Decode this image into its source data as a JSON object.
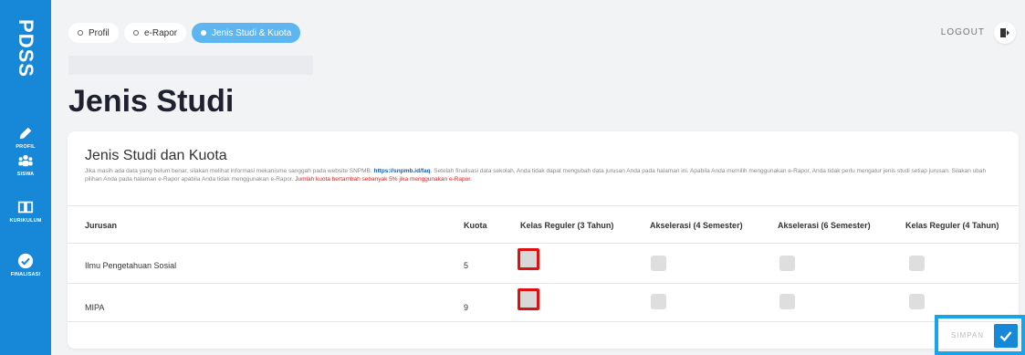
{
  "sidebar": {
    "brand": "PDSS",
    "items": [
      {
        "label": "PROFIL",
        "icon": "pencil-icon"
      },
      {
        "label": "SISWA",
        "icon": "users-icon"
      },
      {
        "label": "KURIKULUM",
        "icon": "book-icon"
      },
      {
        "label": "FINALISASI",
        "icon": "check-circle-icon"
      }
    ],
    "color": "#1787d8"
  },
  "tabs": [
    {
      "label": "Profil",
      "active": false
    },
    {
      "label": "e-Rapor",
      "active": false
    },
    {
      "label": "Jenis Studi & Kuota",
      "active": true
    }
  ],
  "header": {
    "logout_label": "LOGOUT"
  },
  "page": {
    "title": "Jenis Studi"
  },
  "card": {
    "title": "Jenis Studi dan Kuota",
    "desc_part1": "Jika masih ada data yang belum benar, silakan melihat informasi mekanisme sanggah pada website SNPMB: ",
    "desc_link": "https://snpmb.id/faq",
    "desc_part2": ". Setelah finalisasi data sekolah, Anda tidak dapat mengubah data jurusan Anda pada halaman ini. Apabila Anda memilih menggunakan e-Rapor, Anda tidak perlu mengatur jenis studi setiap jurusan. Silakan ubah pilihan Anda pada halaman e-Rapor apabila Anda tidak menggunakan e-Rapor. ",
    "desc_warning": "Jumlah kuota bertambah sebanyak 5% jika menggunakan e-Rapor."
  },
  "table": {
    "columns": [
      "Jurusan",
      "Kuota",
      "Kelas Reguler (3 Tahun)",
      "Akselerasi (4 Semester)",
      "Akselerasi (6 Semester)",
      "Kelas Reguler (4 Tahun)"
    ],
    "rows": [
      {
        "jurusan": "Ilmu Pengetahuan Sosial",
        "kuota": "5",
        "checks": [
          false,
          false,
          false,
          false
        ]
      },
      {
        "jurusan": "MIPA",
        "kuota": "9",
        "checks": [
          false,
          false,
          false,
          false
        ]
      }
    ]
  },
  "save": {
    "label": "SIMPAN"
  },
  "colors": {
    "accent": "#1787d8",
    "tab_active": "#5db6f0",
    "highlight": "#e01010",
    "warning_text": "#e02020"
  }
}
